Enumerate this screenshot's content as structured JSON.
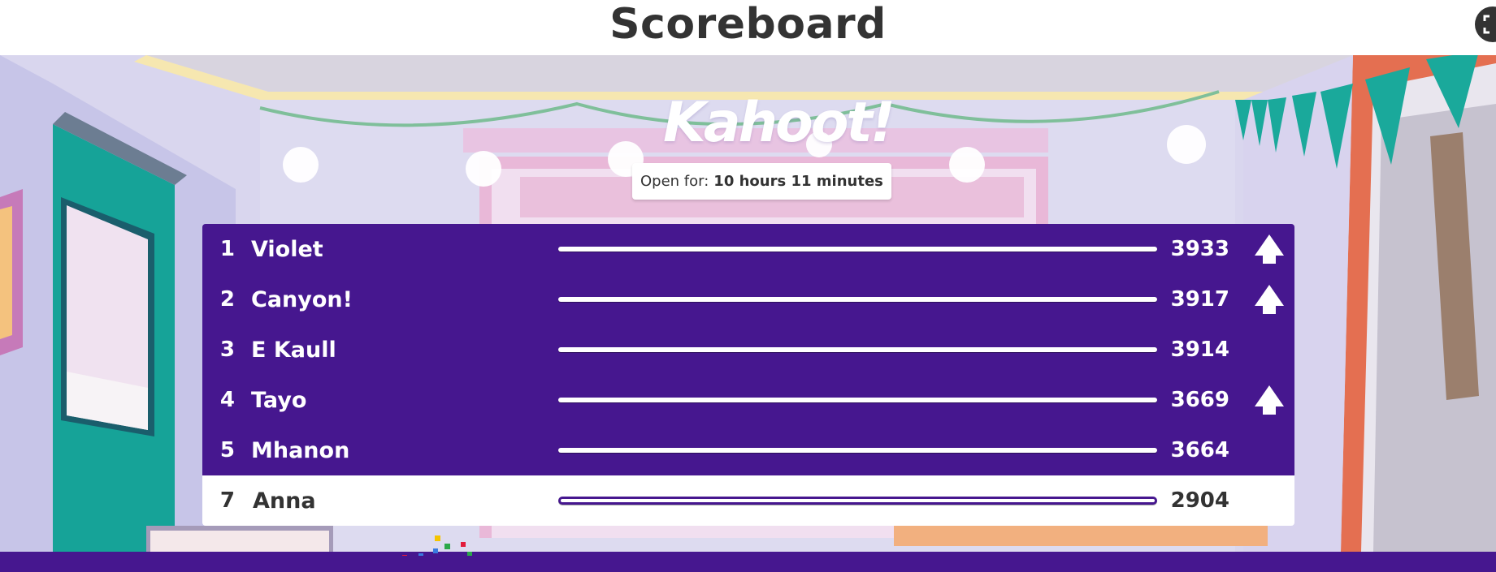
{
  "header": {
    "title": "Scoreboard",
    "fullscreen_icon": "fullscreen-icon"
  },
  "logo": {
    "text": "Kahoot!"
  },
  "status": {
    "open_label": "Open for:",
    "open_value": "10 hours 11 minutes"
  },
  "scoreboard": {
    "rows": [
      {
        "rank": "1",
        "name": "Violet",
        "score": "3933",
        "trend": "up"
      },
      {
        "rank": "2",
        "name": "Canyon!",
        "score": "3917",
        "trend": "up"
      },
      {
        "rank": "3",
        "name": "E Kaull",
        "score": "3914",
        "trend": "none"
      },
      {
        "rank": "4",
        "name": "Tayo",
        "score": "3669",
        "trend": "up"
      },
      {
        "rank": "5",
        "name": "Mhanon",
        "score": "3664",
        "trend": "none"
      }
    ],
    "current_player": {
      "rank": "7",
      "name": "Anna",
      "score": "2904"
    }
  },
  "colors": {
    "brand_purple": "#46178f",
    "teal": "#1aa99b"
  }
}
